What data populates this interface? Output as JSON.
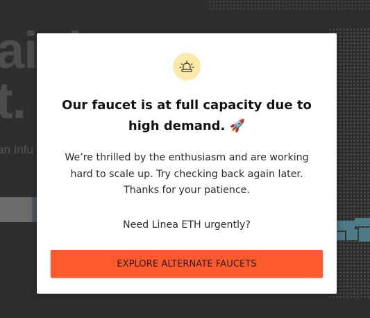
{
  "background": {
    "headline_line1": "aight",
    "headline_line2": "t.",
    "subtext": "an Infu"
  },
  "modal": {
    "icon": "siren-icon",
    "title": "Our faucet is at full capacity due to high demand. 🚀",
    "body_lines": [
      "We’re thrilled by the enthusiasm and are working",
      "hard to scale up. Try checking back again later.",
      "Thanks for your patience."
    ],
    "question": "Need Linea ETH urgently?",
    "cta_label": "EXPLORE ALTERNATE FAUCETS"
  },
  "colors": {
    "backdrop": "#2e2e2e",
    "modal_bg": "#ffffff",
    "icon_badge": "#fde9a9",
    "cta": "#ff5a2e",
    "accent_teal": "#4d7b88"
  }
}
